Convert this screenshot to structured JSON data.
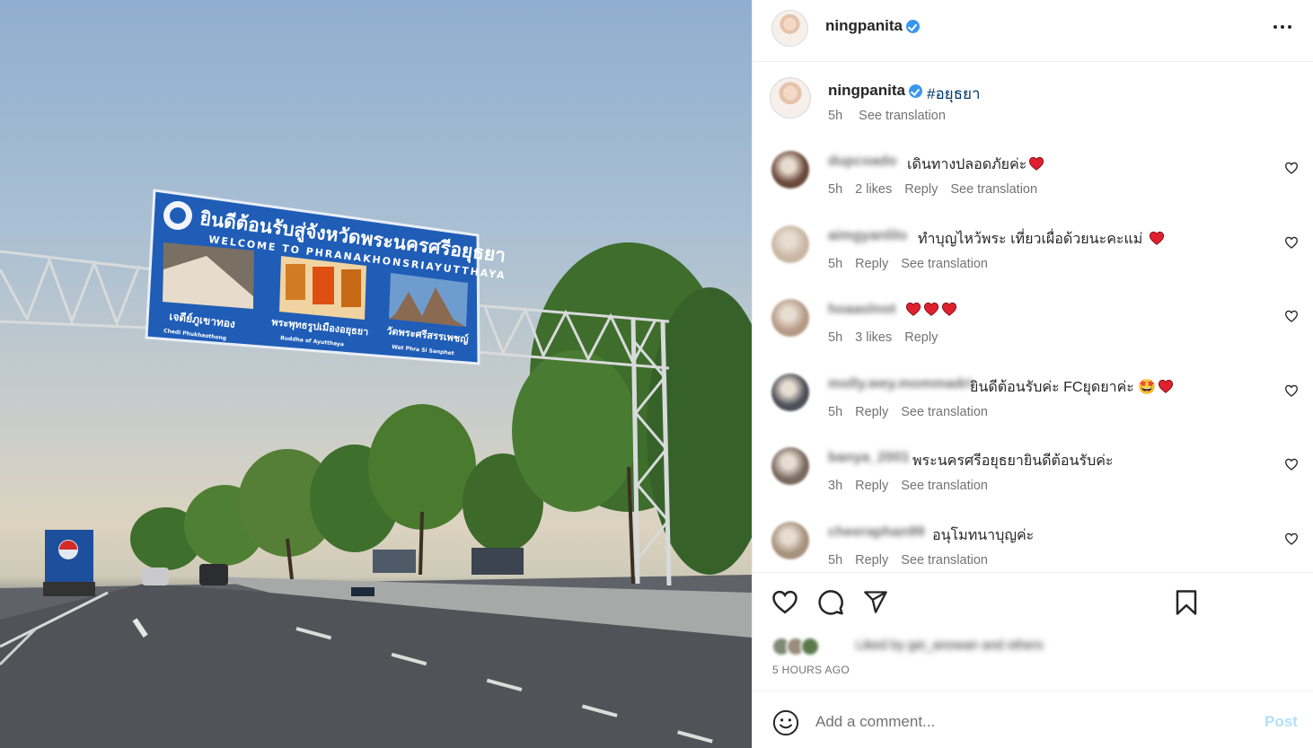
{
  "post": {
    "author": "ningpanita",
    "verified": true,
    "hashtag": "#อยุธยา",
    "caption_time": "5h",
    "see_translation": "See translation",
    "time_ago": "5 HOURS AGO",
    "liked_by_text": "Liked by gei_anowan and others"
  },
  "photo": {
    "sign_title_th": "ยินดีต้อนรับสู่จังหวัดพระนครศรีอยุธยา",
    "sign_title_en": "WELCOME TO PHRANAKHONSRIAYUTTHAYA",
    "sign_captions": [
      {
        "th": "เจดีย์ภูเขาทอง",
        "en": "Chedi Phukhaothong"
      },
      {
        "th": "พระพุทธรูปเมืองอยุธยา",
        "en": "Buddha of Ayutthaya"
      },
      {
        "th": "วัดพระศรีสรรเพชญ์",
        "en": "Wat Phra Si Sanphet"
      }
    ]
  },
  "comments": [
    {
      "user": "dupcoado",
      "text": "เดินทางปลอดภัยค่ะ",
      "hearts": 1,
      "time": "5h",
      "likes": "2 likes",
      "reply": "Reply",
      "translate": "See translation",
      "avatar_color": "#6b4a3a"
    },
    {
      "user": "aimgyanlilo",
      "text": "ทำบุญไหว้พระ เที่ยวเผื่อด้วยนะคะแม่ ",
      "hearts": 1,
      "time": "5h",
      "likes": "",
      "reply": "Reply",
      "translate": "See translation",
      "avatar_color": "#c9b7a4"
    },
    {
      "user": "hoaaslnot",
      "text": "",
      "hearts": 3,
      "time": "5h",
      "likes": "3 likes",
      "reply": "Reply",
      "translate": "",
      "avatar_color": "#b59a86"
    },
    {
      "user": "molly.wey.mommadri",
      "text": "ยินดีต้อนรับค่ะ FCยุดยาค่ะ 🤩",
      "hearts": 1,
      "time": "5h",
      "likes": "",
      "reply": "Reply",
      "translate": "See translation",
      "avatar_color": "#4d5058"
    },
    {
      "user": "banya_2001",
      "text": "พระนครศรีอยุธยายินดีต้อนรับค่ะ",
      "hearts": 0,
      "time": "3h",
      "likes": "",
      "reply": "Reply",
      "translate": "See translation",
      "avatar_color": "#7a6a60"
    },
    {
      "user": "cheeraphan99",
      "text": "อนุโมทนาบุญค่ะ",
      "hearts": 0,
      "time": "5h",
      "likes": "",
      "reply": "Reply",
      "translate": "See translation",
      "avatar_color": "#a7927c"
    }
  ],
  "composer": {
    "placeholder": "Add a comment...",
    "post_label": "Post"
  },
  "colors": {
    "verified": "#3897f0",
    "hashtag": "#00376b",
    "post_button": "#b2dffc",
    "emoji_heart": "#e0202e"
  }
}
